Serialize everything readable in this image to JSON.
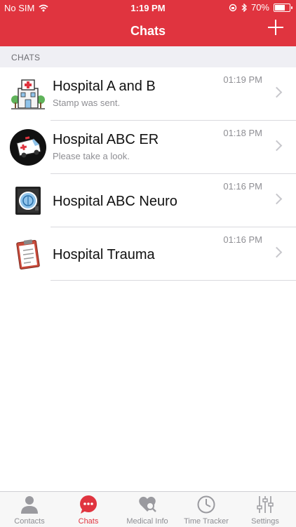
{
  "status_bar": {
    "carrier": "No SIM",
    "time": "1:19 PM",
    "battery_text": "70%",
    "battery_level": 0.7
  },
  "nav": {
    "title": "Chats"
  },
  "section": {
    "header": "CHATS"
  },
  "chats": [
    {
      "title": "Hospital A and B",
      "preview": "Stamp was sent.",
      "time": "01:19 PM",
      "icon": "hospital-building-icon"
    },
    {
      "title": "Hospital ABC ER",
      "preview": "Please take a look.",
      "time": "01:18 PM",
      "icon": "ambulance-icon"
    },
    {
      "title": "Hospital ABC Neuro",
      "preview": "",
      "time": "01:16 PM",
      "icon": "xray-scanner-icon"
    },
    {
      "title": "Hospital Trauma",
      "preview": "",
      "time": "01:16 PM",
      "icon": "clipboard-icon"
    }
  ],
  "tabs": [
    {
      "label": "Contacts",
      "icon": "person-icon"
    },
    {
      "label": "Chats",
      "icon": "chat-bubble-icon",
      "active": true
    },
    {
      "label": "Medical Info",
      "icon": "heart-search-icon"
    },
    {
      "label": "Time Tracker",
      "icon": "clock-icon"
    },
    {
      "label": "Settings",
      "icon": "sliders-icon"
    }
  ],
  "colors": {
    "accent": "#e0343f",
    "inactive": "#8e8e93"
  }
}
